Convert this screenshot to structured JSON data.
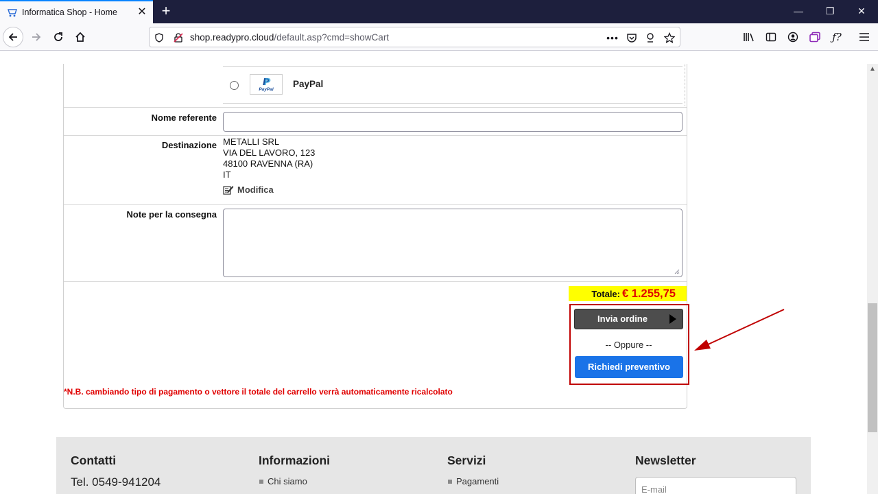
{
  "browser": {
    "tab_title": "Informatica Shop - Home",
    "url_host": "shop.readypro.cloud",
    "url_path": "/default.asp?cmd=showCart"
  },
  "payment": {
    "option_label": "PayPal",
    "logo_text": "PayPal"
  },
  "form": {
    "nome_referente_label": "Nome referente",
    "destinazione_label": "Destinazione",
    "destinazione_lines": [
      "METALLI SRL",
      "VIA DEL LAVORO, 123",
      "48100 RAVENNA (RA)",
      "IT"
    ],
    "modifica_label": "Modifica",
    "note_label": "Note per la consegna"
  },
  "summary": {
    "totale_label": "Totale:",
    "totale_value": "€ 1.255,75",
    "invia_label": "Invia ordine",
    "oppure_label": "-- Oppure --",
    "preventivo_label": "Richiedi preventivo",
    "note": "*N.B. cambiando tipo di pagamento o vettore il totale del carrello verrà automaticamente ricalcolato"
  },
  "footer": {
    "contatti_title": "Contatti",
    "telefono": "Tel. 0549-941204",
    "informazioni_title": "Informazioni",
    "informazioni_item": "Chi siamo",
    "servizi_title": "Servizi",
    "servizi_item": "Pagamenti",
    "newsletter_title": "Newsletter",
    "email_placeholder": "E-mail"
  },
  "colors": {
    "highlight": "#c00000",
    "total_bg": "#ffff00",
    "preventivo_btn": "#1a73e8",
    "invia_btn": "#4d4d4d"
  }
}
